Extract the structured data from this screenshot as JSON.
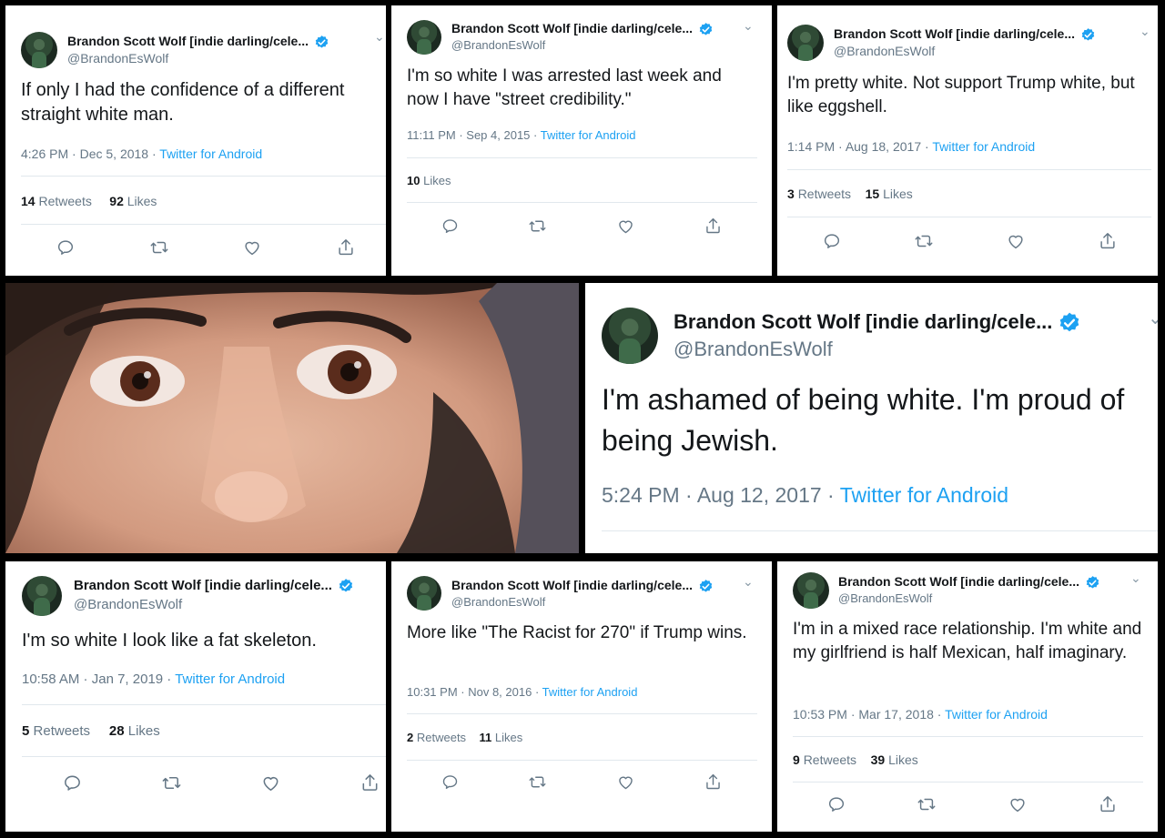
{
  "account": {
    "name": "Brandon Scott Wolf [indie darling/cele...",
    "handle": "@BrandonEsWolf"
  },
  "labels": {
    "retweets": "Retweets",
    "likes": "Likes"
  },
  "tweets": [
    {
      "text": "If only I had the confidence of a different straight white man.",
      "time": "4:26 PM",
      "date": "Dec 5, 2018",
      "source": "Twitter for Android",
      "retweets": "14",
      "likes": "92"
    },
    {
      "text": "I'm so white I was arrested last week and now I have \"street credibility.\"",
      "time": "11:11 PM",
      "date": "Sep 4, 2015",
      "source": "Twitter for Android",
      "likes": "10"
    },
    {
      "text": "I'm pretty white. Not support Trump white, but like eggshell.",
      "time": "1:14 PM",
      "date": "Aug 18, 2017",
      "source": "Twitter for Android",
      "retweets": "3",
      "likes": "15"
    },
    {
      "text": "I'm ashamed of being white. I'm proud of being Jewish.",
      "time": "5:24 PM",
      "date": "Aug 12, 2017",
      "source": "Twitter for Android"
    },
    {
      "text": "I'm so white I look like a fat skeleton.",
      "time": "10:58 AM",
      "date": "Jan 7, 2019",
      "source": "Twitter for Android",
      "retweets": "5",
      "likes": "28"
    },
    {
      "text": "More like \"The Racist for 270\" if Trump wins.",
      "time": "10:31 PM",
      "date": "Nov 8, 2016",
      "source": "Twitter for Android",
      "retweets": "2",
      "likes": "11"
    },
    {
      "text": "I'm in a mixed race relationship. I'm white and my girlfriend is half Mexican, half imaginary.",
      "time": "10:53 PM",
      "date": "Mar 17, 2018",
      "source": "Twitter for Android",
      "retweets": "9",
      "likes": "39"
    }
  ],
  "icons": [
    "reply-icon",
    "retweet-icon",
    "like-icon",
    "share-icon",
    "verified-badge-icon",
    "chevron-down-icon"
  ],
  "colors": {
    "link": "#1da1f2",
    "muted": "#657786",
    "verified": "#1da1f2"
  }
}
